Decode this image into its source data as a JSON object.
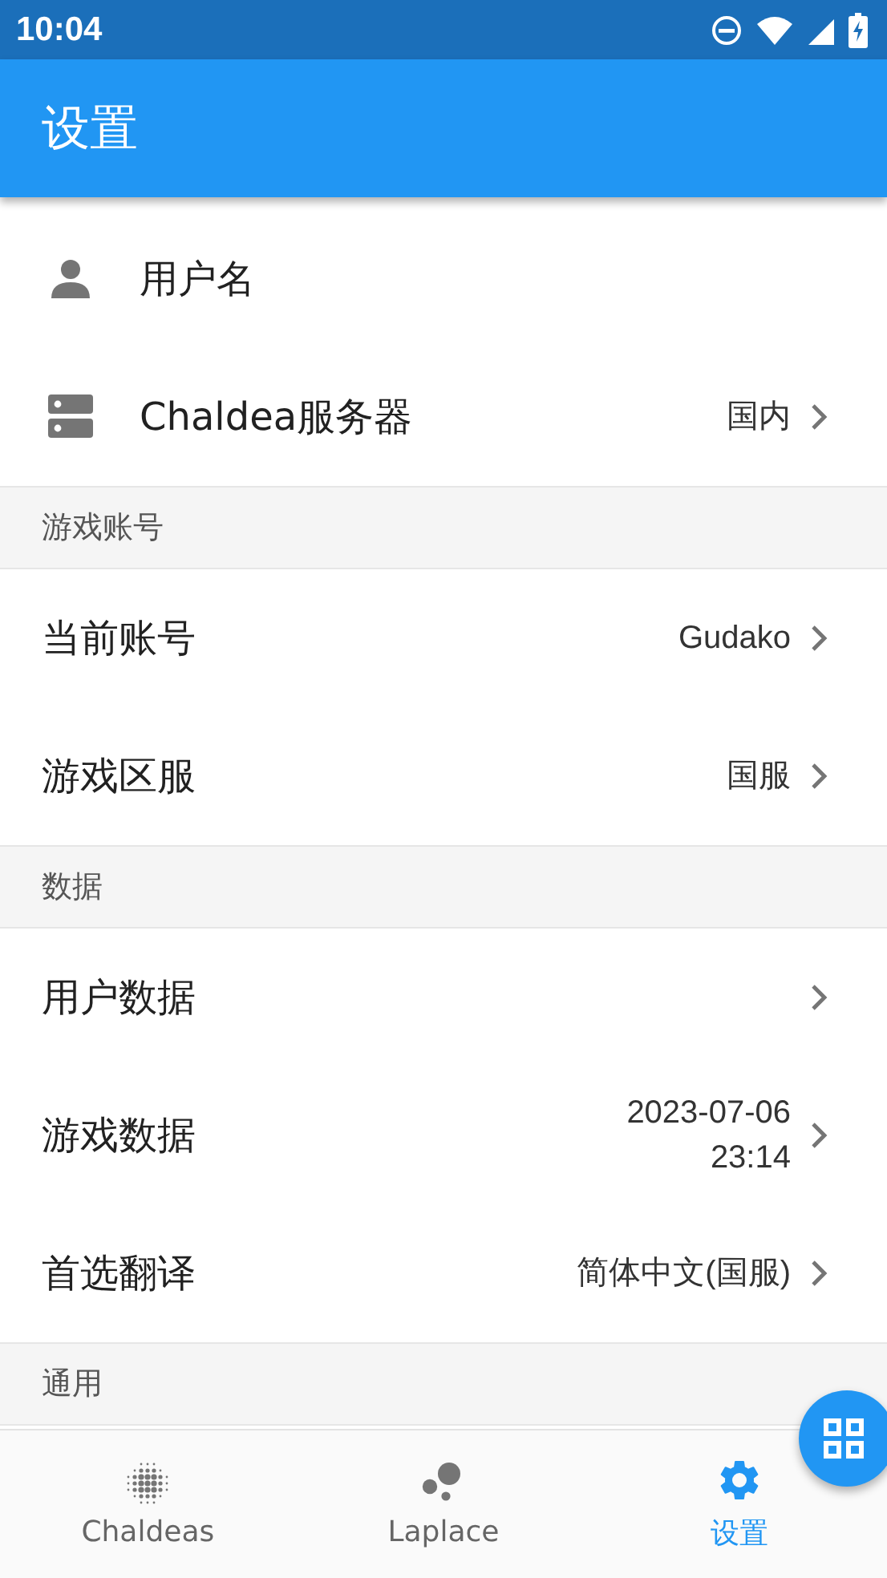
{
  "status_bar": {
    "time": "10:04"
  },
  "app_bar": {
    "title": "设置"
  },
  "sections": [
    {
      "items": [
        {
          "kind": "person",
          "label": "用户名",
          "chevron": false
        },
        {
          "kind": "server",
          "label": "Chaldea服务器",
          "value": "国内",
          "chevron": true
        }
      ]
    },
    {
      "header": "游戏账号",
      "items": [
        {
          "label": "当前账号",
          "value": "Gudako",
          "chevron": true
        },
        {
          "label": "游戏区服",
          "value": "国服",
          "chevron": true
        }
      ]
    },
    {
      "header": "数据",
      "items": [
        {
          "label": "用户数据",
          "chevron": true
        },
        {
          "label": "游戏数据",
          "value": "2023-07-06\n23:14",
          "chevron": true
        },
        {
          "label": "首选翻译",
          "value": "简体中文(国服)",
          "chevron": true
        }
      ]
    },
    {
      "header": "通用"
    }
  ],
  "bottom_nav": [
    {
      "kind": "dots",
      "label": "Chaldeas",
      "selected": false
    },
    {
      "kind": "bubbles",
      "label": "Laplace",
      "selected": false
    },
    {
      "kind": "gear",
      "label": "设置",
      "selected": true
    }
  ],
  "fab": {
    "kind": "grid"
  }
}
